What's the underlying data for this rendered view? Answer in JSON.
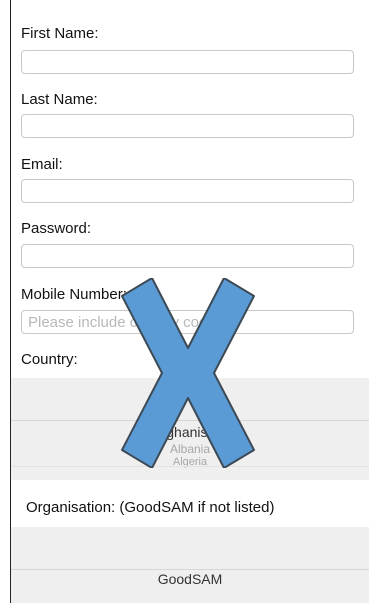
{
  "form": {
    "first_name_label": "First Name:",
    "last_name_label": "Last Name:",
    "email_label": "Email:",
    "password_label": "Password:",
    "mobile_label": "Mobile Number:",
    "mobile_placeholder": "Please include country code",
    "country_label": "Country:",
    "organisation_label": "Organisation: (GoodSAM if not listed)"
  },
  "country_picker": {
    "visible_options": [
      "Afghanistan",
      "Albania",
      "Algeria"
    ]
  },
  "organisation_picker": {
    "selected": "GoodSAM"
  },
  "overlay": {
    "icon": "cross-mark-icon",
    "color": "#5b9bd5"
  }
}
